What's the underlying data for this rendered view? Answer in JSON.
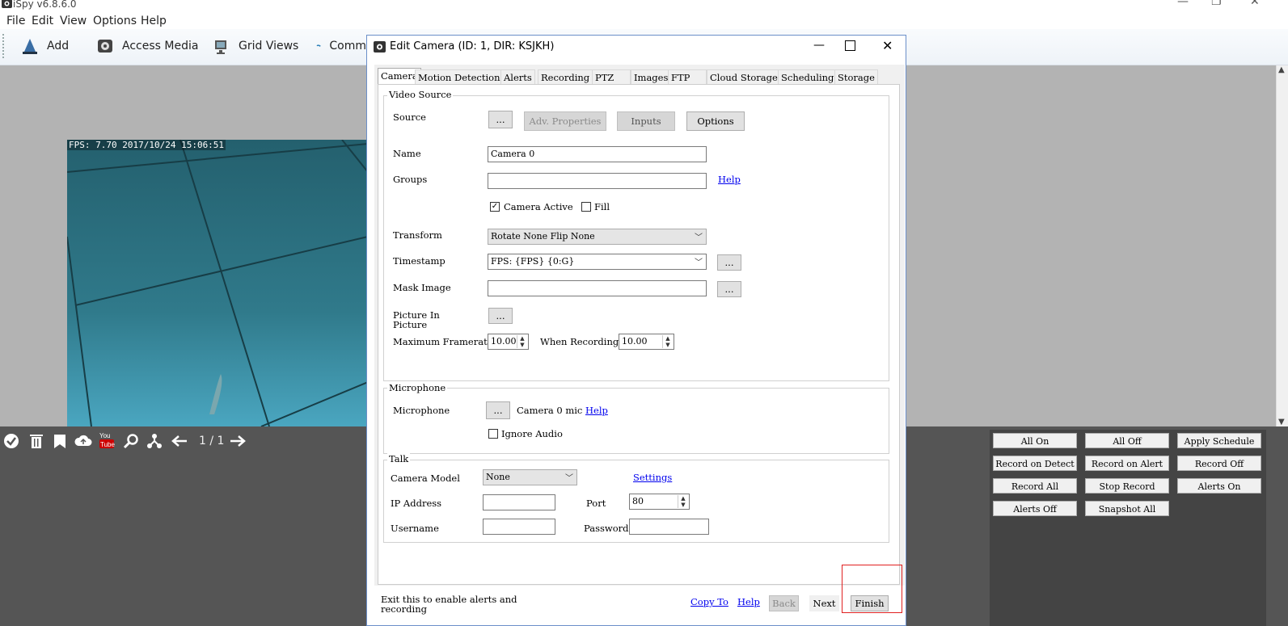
{
  "app": {
    "title": "iSpy v6.8.6.0",
    "menu": [
      "File",
      "Edit",
      "View",
      "Options",
      "Help"
    ],
    "window_controls": {
      "minimize": "—",
      "restore": "❐",
      "close": "✕"
    }
  },
  "toolbar": {
    "buttons": [
      {
        "label": "Add",
        "icon": "add-camera-icon"
      },
      {
        "label": "Access Media",
        "icon": "media-icon"
      },
      {
        "label": "Grid Views",
        "icon": "grid-views-icon"
      },
      {
        "label": "Comm",
        "icon": "commands-icon"
      }
    ]
  },
  "camera_view": {
    "overlay_text": "FPS: 7.70 2017/10/24 15:06:51",
    "pager": "1 / 1",
    "tools": [
      "check-icon",
      "trash-icon",
      "bookmark-icon",
      "upload-icon",
      "youtube-icon",
      "search-icon",
      "network-icon",
      "arrow-left-icon",
      "arrow-right-icon"
    ]
  },
  "actions": {
    "buttons": [
      "All On",
      "All Off",
      "Apply Schedule",
      "Record on Detect",
      "Record on Alert",
      "Record Off",
      "Record All",
      "Stop Record",
      "Alerts On",
      "Alerts Off",
      "Snapshot All"
    ]
  },
  "dialog": {
    "title": "Edit Camera (ID: 1, DIR: KSJKH)",
    "tabs": [
      "Camera",
      "Motion Detection",
      "Alerts",
      "Recording",
      "PTZ",
      "Images",
      "FTP",
      "Cloud Storage",
      "Scheduling",
      "Storage"
    ],
    "active_tab": "Camera",
    "video_source": {
      "group_label": "Video Source",
      "source_label": "Source",
      "source_btn": "...",
      "adv_properties": "Adv. Properties",
      "inputs": "Inputs",
      "options": "Options",
      "name_label": "Name",
      "name_value": "Camera 0",
      "groups_label": "Groups",
      "groups_value": "",
      "help": "Help",
      "camera_active": "Camera Active",
      "fill": "Fill",
      "transform_label": "Transform",
      "transform_value": "Rotate None Flip None",
      "timestamp_label": "Timestamp",
      "timestamp_value": "FPS: {FPS} {0:G}",
      "mask_label": "Mask Image",
      "mask_value": "",
      "pip_label_1": "Picture In",
      "pip_label_2": "Picture",
      "ellipsis": "...",
      "max_framerate_label": "Maximum Framerate",
      "max_framerate_value": "10.00",
      "when_recording_label": "When Recording",
      "when_recording_value": "10.00"
    },
    "microphone": {
      "group_label": "Microphone",
      "label": "Microphone",
      "btn": "...",
      "value": "Camera 0 mic",
      "help": "Help",
      "ignore_audio": "Ignore Audio"
    },
    "talk": {
      "group_label": "Talk",
      "camera_model_label": "Camera Model",
      "camera_model_value": "None",
      "settings": "Settings",
      "ip_label": "IP Address",
      "ip_value": "",
      "port_label": "Port",
      "port_value": "80",
      "username_label": "Username",
      "username_value": "",
      "password_label": "Password",
      "password_value": ""
    },
    "footer": {
      "hint_1": "Exit this to enable alerts and",
      "hint_2": "recording",
      "copy_to": "Copy To",
      "help": "Help",
      "back": "Back",
      "next": "Next",
      "finish": "Finish"
    }
  },
  "colors": {
    "workspace": "#b3b3b3",
    "bottom_panel": "#555555",
    "camera_feed": "#2f7484",
    "dialog_border": "#6b8fc9",
    "highlight": "#e02020"
  }
}
